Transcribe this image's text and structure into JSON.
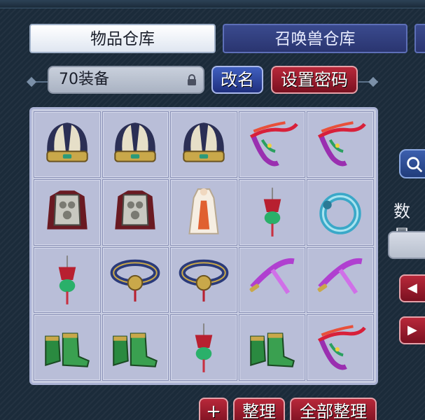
{
  "tabs": {
    "items_warehouse": "物品仓库",
    "pet_warehouse": "召唤兽仓库"
  },
  "storage": {
    "name": "70装备",
    "rename_label": "改名",
    "set_password_label": "设置密码"
  },
  "grid": {
    "slots": [
      {
        "item": "helmet-icon"
      },
      {
        "item": "helmet-icon"
      },
      {
        "item": "helmet-icon"
      },
      {
        "item": "phoenix-ornament-icon"
      },
      {
        "item": "phoenix-ornament-icon"
      },
      {
        "item": "armor-icon"
      },
      {
        "item": "armor-icon"
      },
      {
        "item": "robe-icon"
      },
      {
        "item": "tassel-pendant-icon"
      },
      {
        "item": "jade-ring-icon"
      },
      {
        "item": "tassel-pendant-icon"
      },
      {
        "item": "belt-icon"
      },
      {
        "item": "belt-icon"
      },
      {
        "item": "ribbon-weapon-icon"
      },
      {
        "item": "ribbon-weapon-icon"
      },
      {
        "item": "boots-icon"
      },
      {
        "item": "boots-icon"
      },
      {
        "item": "tassel-pendant-icon"
      },
      {
        "item": "boots-icon"
      },
      {
        "item": "phoenix-ornament-icon"
      }
    ]
  },
  "bottom": {
    "add_label": "+",
    "sort_label": "整理",
    "sort_all_label": "全部整理"
  },
  "side": {
    "quantity_label": "数量",
    "search_icon": "search-icon",
    "prev_icon": "arrow-left-icon",
    "next_icon": "arrow-right-icon"
  },
  "colors": {
    "active_tab": "#ffffff",
    "inactive_tab": "#2a3570",
    "blue_button": "#1f2f7e",
    "red_button": "#7a1020",
    "grid_bg": "#c8cde2"
  }
}
